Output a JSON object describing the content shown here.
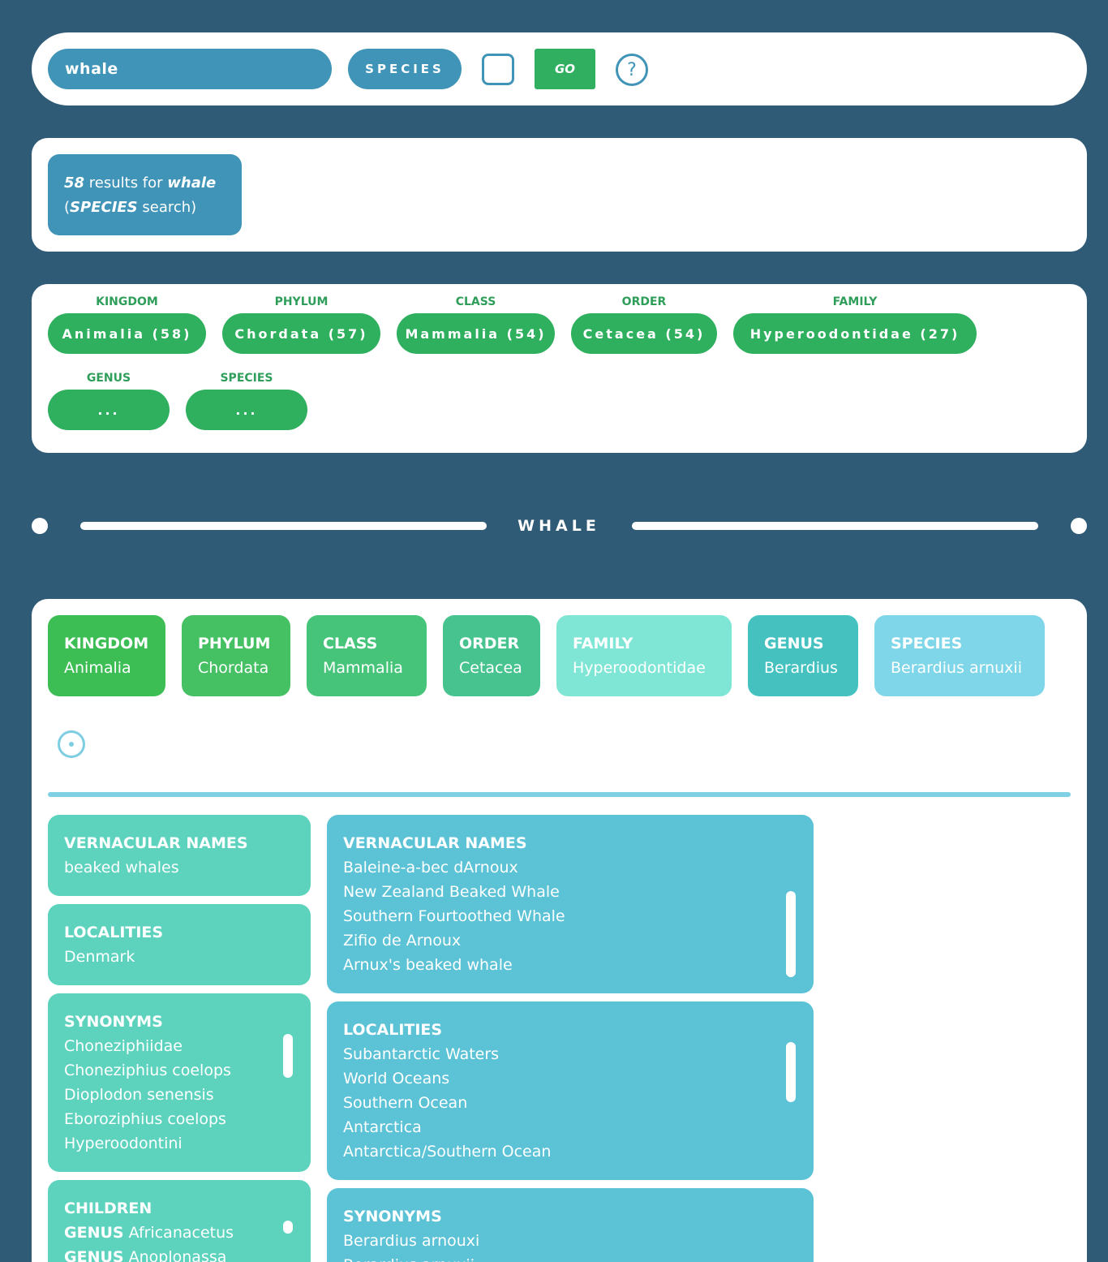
{
  "search": {
    "query": "whale",
    "type_label": "SPECIES",
    "go_label": "GO",
    "help_glyph": "?",
    "help_icon": "question-circle-icon",
    "checkbox_checked": false
  },
  "results": {
    "count": "58",
    "text_results_for": " results for ",
    "query": "whale",
    "open_paren": "(",
    "search_type": "SPECIES",
    "text_search": " search)"
  },
  "filters": [
    {
      "label": "KINGDOM",
      "value": "Animalia (58)"
    },
    {
      "label": "PHYLUM",
      "value": "Chordata (57)"
    },
    {
      "label": "CLASS",
      "value": "Mammalia (54)"
    },
    {
      "label": "ORDER",
      "value": "Cetacea (54)"
    },
    {
      "label": "FAMILY",
      "value": "Hyperoodontidae (27)"
    },
    {
      "label": "GENUS",
      "value": "..."
    },
    {
      "label": "SPECIES",
      "value": "..."
    }
  ],
  "divider": {
    "title": "WHALE"
  },
  "taxonomy": [
    {
      "rank": "KINGDOM",
      "value": "Animalia",
      "color": "#3dbe55"
    },
    {
      "rank": "PHYLUM",
      "value": "Chordata",
      "color": "#45c063"
    },
    {
      "rank": "CLASS",
      "value": "Mammalia",
      "color": "#46c47a"
    },
    {
      "rank": "ORDER",
      "value": "Cetacea",
      "color": "#47c38f"
    },
    {
      "rank": "FAMILY",
      "value": "Hyperoodontidae",
      "color": "#7fe6d5"
    },
    {
      "rank": "GENUS",
      "value": "Berardius",
      "color": "#45c2c0"
    },
    {
      "rank": "SPECIES",
      "value": "Berardius arnuxii",
      "color": "#7ed6e8"
    }
  ],
  "target_icon": "target-icon",
  "family_info": {
    "vernacular": {
      "title": "VERNACULAR NAMES",
      "items": [
        "beaked whales"
      ]
    },
    "localities": {
      "title": "LOCALITIES",
      "items": [
        "Denmark"
      ]
    },
    "synonyms": {
      "title": "SYNONYMS",
      "items": [
        "Choneziphiidae",
        "Choneziphius coelops",
        "Dioplodon senensis",
        "Eboroziphius coelops",
        "Hyperoodontini"
      ]
    },
    "children": {
      "title": "CHILDREN",
      "items": [
        {
          "rank": "GENUS",
          "name": "Africanacetus"
        },
        {
          "rank": "GENUS",
          "name": "Anoplonassa"
        }
      ]
    }
  },
  "species_info": {
    "vernacular": {
      "title": "VERNACULAR NAMES",
      "items": [
        "Baleine-a-bec dArnoux",
        "New Zealand Beaked Whale",
        "Southern Fourtoothed Whale",
        "Zifio de Arnoux",
        "Arnux's beaked whale"
      ]
    },
    "localities": {
      "title": "LOCALITIES",
      "items": [
        "Subantarctic Waters",
        "World Oceans",
        "Southern Ocean",
        "Antarctica",
        "Antarctica/Southern Ocean"
      ]
    },
    "synonyms": {
      "title": "SYNONYMS",
      "items": [
        "Berardius arnouxi",
        "Berardius arnuxii"
      ]
    }
  },
  "colors": {
    "background": "#305b76",
    "primary_blue": "#4094b8",
    "green": "#2fb05e",
    "teal_card": "#5dd3be",
    "blue_card": "#5cc2d6"
  }
}
